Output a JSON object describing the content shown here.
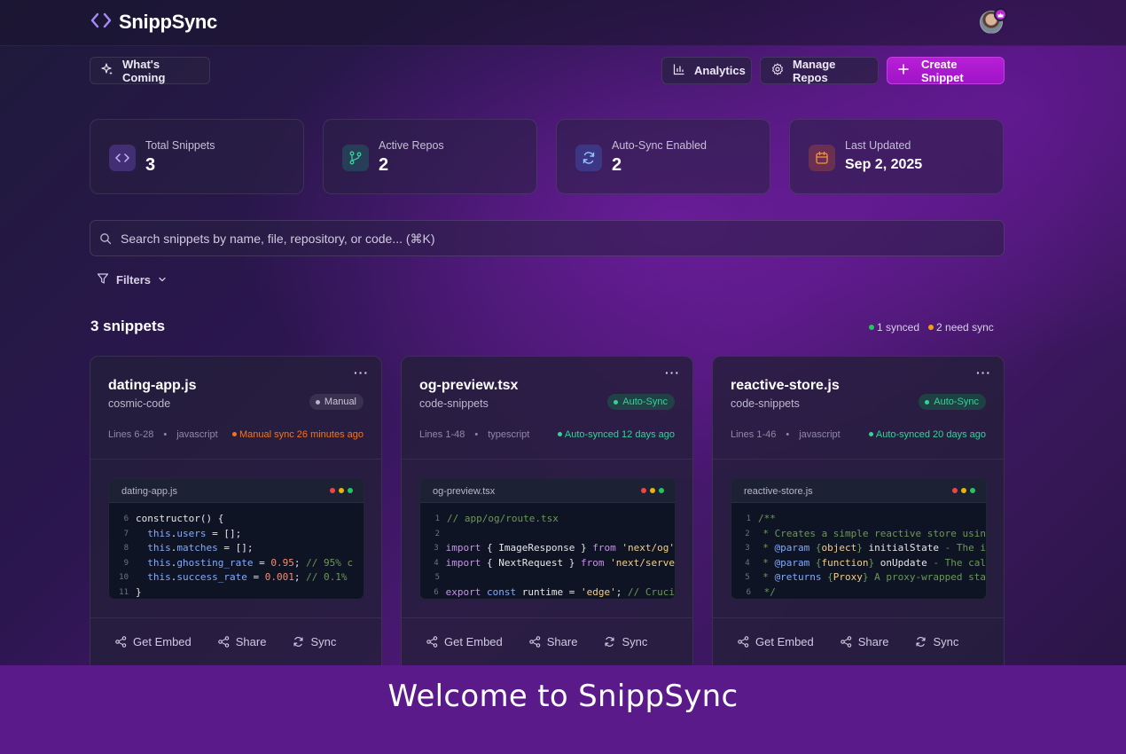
{
  "app": {
    "title": "SnippSync"
  },
  "toolbar": {
    "whats_coming": "What's Coming",
    "analytics": "Analytics",
    "manage_repos": "Manage Repos",
    "create_snippet": "Create Snippet"
  },
  "stats": [
    {
      "label": "Total Snippets",
      "value": "3",
      "icon": "code-icon",
      "color": "#8b5cf6"
    },
    {
      "label": "Active Repos",
      "value": "2",
      "icon": "git-branch-icon",
      "color": "#10b981"
    },
    {
      "label": "Auto-Sync Enabled",
      "value": "2",
      "icon": "refresh-icon",
      "color": "#3b82f6"
    },
    {
      "label": "Last Updated",
      "value": "Sep 2, 2025",
      "icon": "calendar-icon",
      "color": "#f97316"
    }
  ],
  "search": {
    "placeholder": "Search snippets by name, file, repository, or code... (⌘K)"
  },
  "filters": {
    "label": "Filters"
  },
  "list": {
    "count_label": "3 snippets",
    "synced": "1 synced",
    "need_sync": "2 need sync"
  },
  "snippets": [
    {
      "title": "dating-app.js",
      "repo": "cosmic-code",
      "badge": "Manual",
      "lines": "Lines 6-28",
      "language": "javascript",
      "status": "Manual sync 26 minutes ago",
      "file": "dating-app.js"
    },
    {
      "title": "og-preview.tsx",
      "repo": "code-snippets",
      "badge": "Auto-Sync",
      "lines": "Lines 1-48",
      "language": "typescript",
      "status": "Auto-synced 12 days ago",
      "file": "og-preview.tsx"
    },
    {
      "title": "reactive-store.js",
      "repo": "code-snippets",
      "badge": "Auto-Sync",
      "lines": "Lines 1-46",
      "language": "javascript",
      "status": "Auto-synced 20 days ago",
      "file": "reactive-store.js"
    }
  ],
  "card_actions": {
    "embed": "Get Embed",
    "share": "Share",
    "sync": "Sync",
    "menu": "···"
  },
  "meta_separator": "•",
  "caption": "Welcome to SnippSync",
  "colors": {
    "accent": "#a21caf",
    "synced": "#22c55e",
    "need_sync": "#f59e0b",
    "manual_status": "#f97316",
    "auto_status": "#34d399"
  }
}
